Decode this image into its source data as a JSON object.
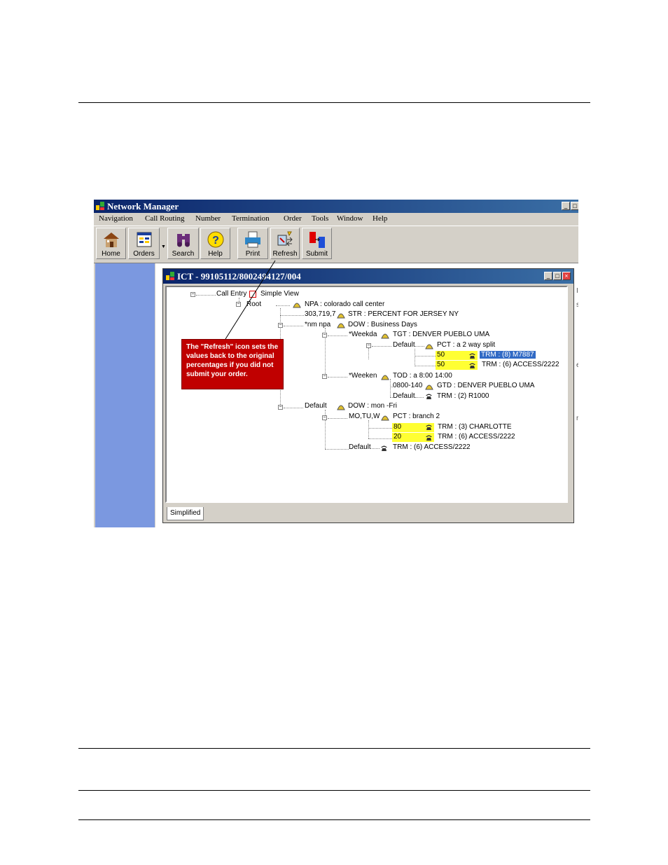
{
  "app": {
    "title": "Network Manager",
    "menu": [
      "Navigation",
      "Call Routing",
      "Number",
      "Termination",
      "Order",
      "Tools",
      "Window",
      "Help"
    ],
    "toolbar": [
      {
        "label": "Home",
        "icon": "house-icon"
      },
      {
        "label": "Orders",
        "icon": "orders-icon"
      },
      {
        "label": "Search",
        "icon": "binoculars-icon"
      },
      {
        "label": "Help",
        "icon": "help-icon"
      },
      {
        "label": "Print",
        "icon": "printer-icon"
      },
      {
        "label": "Refresh",
        "icon": "refresh-icon"
      },
      {
        "label": "Submit",
        "icon": "submit-icon"
      }
    ],
    "right_edge_marks": [
      "I",
      "s",
      "e",
      "r"
    ]
  },
  "child": {
    "title": "ICT - 99105112/8002494127/004",
    "tab": "Simplified"
  },
  "tree": {
    "call_entry": "Call Entry",
    "simple_view": "Simple View",
    "root": "Root",
    "npa": "NPA : colorado call center",
    "n_303": "303,719,7",
    "str": "STR : PERCENT FOR JERSEY NY",
    "nm_npa": "*nm npa",
    "dow_bd": "DOW : Business Days",
    "weekda": "*Weekda",
    "tgt": "TGT : DENVER PUEBLO UMA",
    "default1": "Default",
    "pct_split": "PCT : a 2 way split",
    "v50a": "50",
    "trm_m7887": "TRM : (8) M7887",
    "v50b": "50",
    "trm_access_a": "TRM : (6) ACCESS/2222",
    "weeken": "*Weeken",
    "tod": "TOD : a 8:00 14:00",
    "n_0800": "0800-140",
    "gtd": "GTD : DENVER PUEBLO UMA",
    "default2": "Default",
    "trm_r1000": "TRM : (2) R1000",
    "default3": "Default",
    "dow_mon": "DOW : mon -Fri",
    "mo_tu": "MO,TU,W",
    "pct_branch": "PCT : branch 2",
    "v80": "80",
    "trm_charlotte": "TRM : (3) CHARLOTTE",
    "v20": "20",
    "trm_access_b": "TRM : (6) ACCESS/2222",
    "default4": "Default",
    "trm_access_c": "TRM : (6) ACCESS/2222"
  },
  "callout": {
    "text": "The \"Refresh\" icon sets the values back to the original percentages if you did not submit your order."
  },
  "colors": {
    "title_bar": "#0a246a",
    "left_panel": "#7b98e0",
    "callout": "#c00000",
    "value_highlight": "#ffff33",
    "selection": "#316ac5"
  }
}
